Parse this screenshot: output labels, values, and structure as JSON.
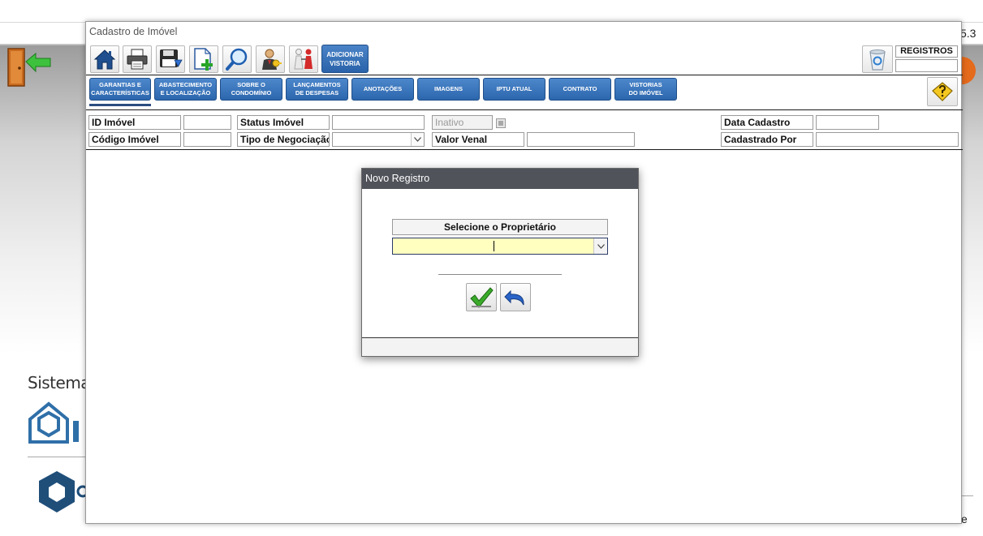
{
  "background": {
    "version_fragment": "5.3",
    "brand_text": "Sistema I",
    "bottom_fragment": "e"
  },
  "form": {
    "title": "Cadastro de Imóvel",
    "toolbar": {
      "add_vistoria_line1": "ADICIONAR",
      "add_vistoria_line2": "VISTORIA",
      "registros_label": "REGISTROS",
      "registros_value": ""
    },
    "tabs": [
      {
        "line1": "GARANTIAS E",
        "line2": "CARACTERÍSTICAS"
      },
      {
        "line1": "ABASTECIMENTO",
        "line2": "E LOCALIZAÇÃO"
      },
      {
        "line1": "SOBRE O",
        "line2": "CONDOMÍNIO"
      },
      {
        "line1": "LANÇAMENTOS",
        "line2": "DE DESPESAS"
      },
      {
        "line1": "ANOTAÇÕES",
        "line2": ""
      },
      {
        "line1": "IMAGENS",
        "line2": ""
      },
      {
        "line1": "IPTU ATUAL",
        "line2": ""
      },
      {
        "line1": "CONTRATO",
        "line2": ""
      },
      {
        "line1": "VISTORIAS",
        "line2": "DO IMÓVEL"
      }
    ],
    "fields": {
      "id_imovel": {
        "label": "ID Imóvel",
        "value": ""
      },
      "codigo_imovel": {
        "label": "Código Imóvel",
        "value": ""
      },
      "status_imovel": {
        "label": "Status Imóvel",
        "value": ""
      },
      "tipo_negociacao": {
        "label": "Tipo de Negociação",
        "value": ""
      },
      "inativo": {
        "label": "Inativo"
      },
      "valor_venal": {
        "label": "Valor Venal",
        "value": ""
      },
      "data_cadastro": {
        "label": "Data Cadastro",
        "value": ""
      },
      "cadastrado_por": {
        "label": "Cadastrado Por",
        "value": ""
      }
    }
  },
  "dialog": {
    "title": "Novo Registro",
    "label": "Selecione o Proprietário",
    "select_value": "",
    "highlight_color": "#ffffc0"
  },
  "icons": {
    "home": "home-icon",
    "print": "printer-icon",
    "save": "save-icon",
    "new": "new-document-icon",
    "search": "magnifier-icon",
    "owner": "owner-key-icon",
    "people": "people-icon",
    "recycle": "recycle-bin-icon",
    "help": "help-icon",
    "confirm": "checkmark-icon",
    "undo": "undo-icon"
  }
}
